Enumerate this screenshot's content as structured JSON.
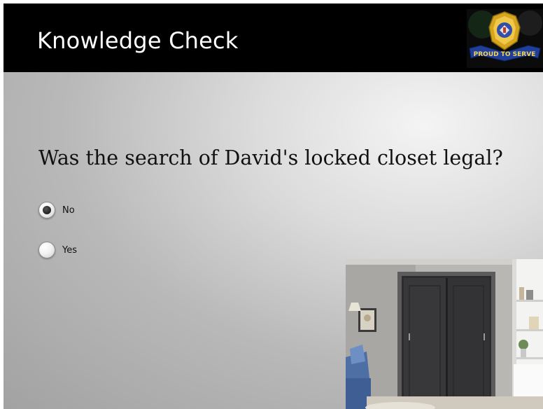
{
  "slide": {
    "title": "Knowledge Check",
    "logo": {
      "icon": "police-badge-icon",
      "banner_text": "PROUD TO SERVE"
    }
  },
  "question": {
    "text": "Was the search of David's locked closet legal?",
    "options": [
      {
        "label": "No",
        "selected": true
      },
      {
        "label": "Yes",
        "selected": false
      }
    ]
  },
  "image": {
    "icon": "closet-door-photo"
  },
  "colors": {
    "header": "#000000",
    "title": "#ffffff",
    "banner": "#1f3f9a",
    "badge_gold": "#d6a51e"
  }
}
